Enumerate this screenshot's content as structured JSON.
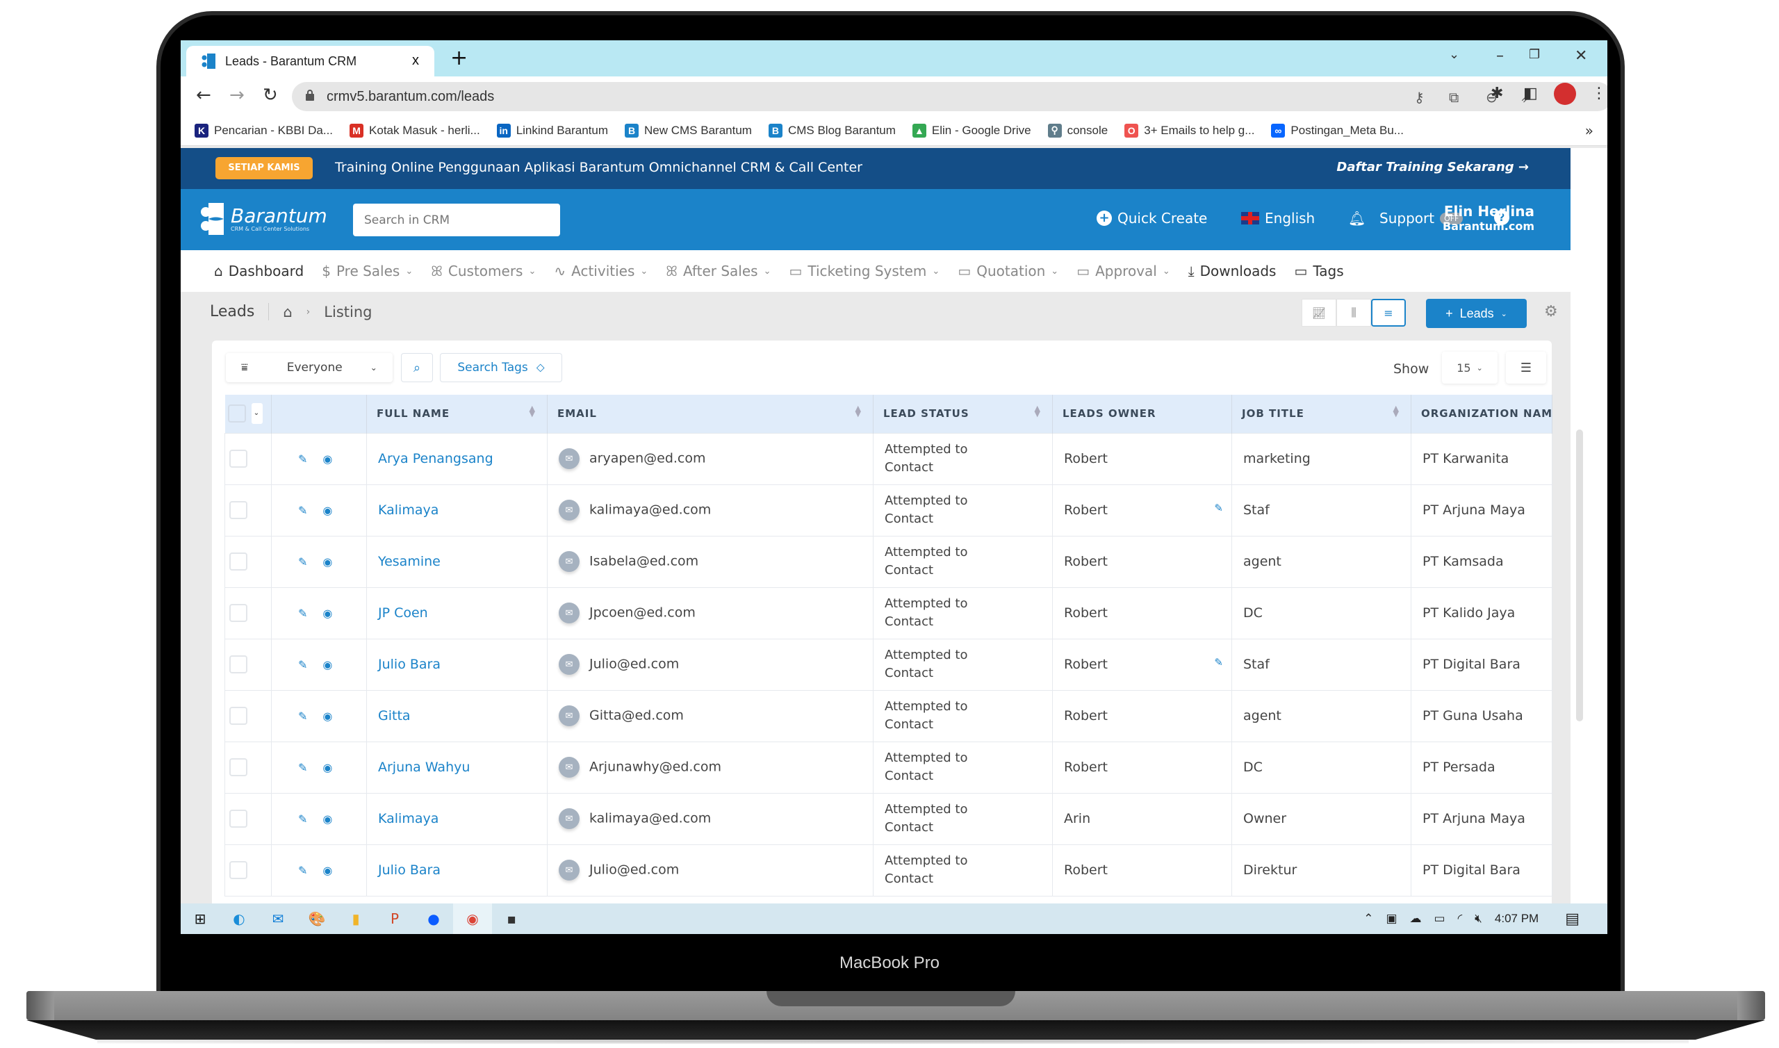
{
  "device": {
    "label": "MacBook Pro"
  },
  "browser": {
    "tab_title": "Leads - Barantum CRM",
    "tab_close": "x",
    "new_tab": "+",
    "url": "crmv5.barantum.com/leads",
    "window_controls": {
      "dropdown": "⌄",
      "minimize": "–",
      "restore": "❐",
      "close": "✕"
    },
    "bookmarks": [
      {
        "label": "Pencarian - KBBI Da...",
        "icon": "kbbi-icon",
        "glyph": "K",
        "color": "#1a237e"
      },
      {
        "label": "Kotak Masuk - herli...",
        "icon": "gmail-icon",
        "glyph": "M",
        "color": "#d93025"
      },
      {
        "label": "Linkind Barantum",
        "icon": "linkedin-icon",
        "glyph": "in",
        "color": "#0a66c2"
      },
      {
        "label": "New CMS Barantum",
        "icon": "barantum-icon",
        "glyph": "B",
        "color": "#1b83c9"
      },
      {
        "label": "CMS Blog Barantum",
        "icon": "barantum-icon",
        "glyph": "B",
        "color": "#1b83c9"
      },
      {
        "label": "Elin - Google Drive",
        "icon": "google-drive-icon",
        "glyph": "▲",
        "color": "#34a853"
      },
      {
        "label": "console",
        "icon": "console-icon",
        "glyph": "⚲",
        "color": "#607d8b"
      },
      {
        "label": "3+ Emails to help g...",
        "icon": "hubspot-icon",
        "glyph": "O",
        "color": "#ef5350"
      },
      {
        "label": "Postingan_Meta Bu...",
        "icon": "meta-icon",
        "glyph": "∞",
        "color": "#0866ff"
      }
    ],
    "bookmarks_more": "»"
  },
  "banner": {
    "badge": "SETIAP KAMIS",
    "text": "Training Online Penggunaan Aplikasi Barantum Omnichannel CRM & Call Center",
    "cta": "Daftar Training Sekarang →"
  },
  "header": {
    "logo_name": "Barantum",
    "logo_tagline": "CRM & Call Center Solutions",
    "search_placeholder": "Search in CRM",
    "quick_create": "Quick Create",
    "language": "English",
    "support": "Support",
    "support_toggle": "OFF",
    "user_name": "Elin Herlina",
    "user_org": "Barantum.com"
  },
  "nav": {
    "items": [
      {
        "label": "Dashboard",
        "icon": "⌂",
        "dropdown": false,
        "dark": true
      },
      {
        "label": "Pre Sales",
        "icon": "$",
        "dropdown": true,
        "dark": false
      },
      {
        "label": "Customers",
        "icon": "ꕤ",
        "dropdown": true,
        "dark": false
      },
      {
        "label": "Activities",
        "icon": "∿",
        "dropdown": true,
        "dark": false
      },
      {
        "label": "After Sales",
        "icon": "ꕤ",
        "dropdown": true,
        "dark": false
      },
      {
        "label": "Ticketing System",
        "icon": "▭",
        "dropdown": true,
        "dark": false
      },
      {
        "label": "Quotation",
        "icon": "▭",
        "dropdown": true,
        "dark": false
      },
      {
        "label": "Approval",
        "icon": "▭",
        "dropdown": true,
        "dark": false
      },
      {
        "label": "Downloads",
        "icon": "⤓",
        "dropdown": false,
        "dark": true
      },
      {
        "label": "Tags",
        "icon": "▭",
        "dropdown": false,
        "dark": true
      }
    ],
    "more": "»"
  },
  "page": {
    "title": "Leads",
    "breadcrumb_current": "Listing",
    "add_button": "Leads",
    "filter_value": "Everyone",
    "search_tags": "Search Tags",
    "show_label": "Show",
    "show_value": "15"
  },
  "table": {
    "columns": [
      "FULL NAME",
      "EMAIL",
      "LEAD STATUS",
      "LEADS OWNER",
      "JOB TITLE",
      "ORGANIZATION NAM"
    ],
    "rows": [
      {
        "name": "Arya Penangsang",
        "email": "aryapen@ed.com",
        "status": "Attempted to Contact",
        "owner": "Robert",
        "owner_edit": false,
        "job": "marketing",
        "org": "PT Karwanita"
      },
      {
        "name": "Kalimaya",
        "email": "kalimaya@ed.com",
        "status": "Attempted to Contact",
        "owner": "Robert",
        "owner_edit": true,
        "job": "Staf",
        "org": "PT Arjuna Maya"
      },
      {
        "name": "Yesamine",
        "email": "Isabela@ed.com",
        "status": "Attempted to Contact",
        "owner": "Robert",
        "owner_edit": false,
        "job": "agent",
        "org": "PT Kamsada"
      },
      {
        "name": "JP Coen",
        "email": "Jpcoen@ed.com",
        "status": "Attempted to Contact",
        "owner": "Robert",
        "owner_edit": false,
        "job": "DC",
        "org": "PT Kalido Jaya"
      },
      {
        "name": "Julio Bara",
        "email": "Julio@ed.com",
        "status": "Attempted to Contact",
        "owner": "Robert",
        "owner_edit": true,
        "job": "Staf",
        "org": "PT Digital Bara"
      },
      {
        "name": "Gitta",
        "email": "Gitta@ed.com",
        "status": "Attempted to Contact",
        "owner": "Robert",
        "owner_edit": false,
        "job": "agent",
        "org": "PT Guna Usaha"
      },
      {
        "name": "Arjuna Wahyu",
        "email": "Arjunawhy@ed.com",
        "status": "Attempted to Contact",
        "owner": "Robert",
        "owner_edit": false,
        "job": "DC",
        "org": "PT Persada"
      },
      {
        "name": "Kalimaya",
        "email": "kalimaya@ed.com",
        "status": "Attempted to Contact",
        "owner": "Arin",
        "owner_edit": false,
        "job": "Owner",
        "org": "PT Arjuna Maya"
      },
      {
        "name": "Julio Bara",
        "email": "Julio@ed.com",
        "status": "Attempted to Contact",
        "owner": "Robert",
        "owner_edit": false,
        "job": "Direktur",
        "org": "PT Digital Bara"
      }
    ]
  },
  "taskbar": {
    "apps": [
      {
        "name": "windows-start-icon",
        "glyph": "⊞",
        "color": "#111"
      },
      {
        "name": "edge-icon",
        "glyph": "◐",
        "color": "#1a8dd8"
      },
      {
        "name": "mail-app-icon",
        "glyph": "✉",
        "color": "#0a7bd6"
      },
      {
        "name": "paint-icon",
        "glyph": "🎨",
        "color": "#e88"
      },
      {
        "name": "file-explorer-icon",
        "glyph": "▮",
        "color": "#f0b429"
      },
      {
        "name": "powerpoint-icon",
        "glyph": "P",
        "color": "#d24726"
      },
      {
        "name": "zoom-icon",
        "glyph": "●",
        "color": "#0b5cff"
      },
      {
        "name": "chrome-icon",
        "glyph": "◉",
        "color": "#db4437"
      },
      {
        "name": "sticky-notes-icon",
        "glyph": "▪",
        "color": "#333"
      }
    ],
    "time": "4:07 PM"
  },
  "colors": {
    "brand": "#1b83c9",
    "banner": "#144e87",
    "badge": "#f7a531",
    "tabbar": "#b9e8f3",
    "table_header": "#e0ecfa"
  }
}
